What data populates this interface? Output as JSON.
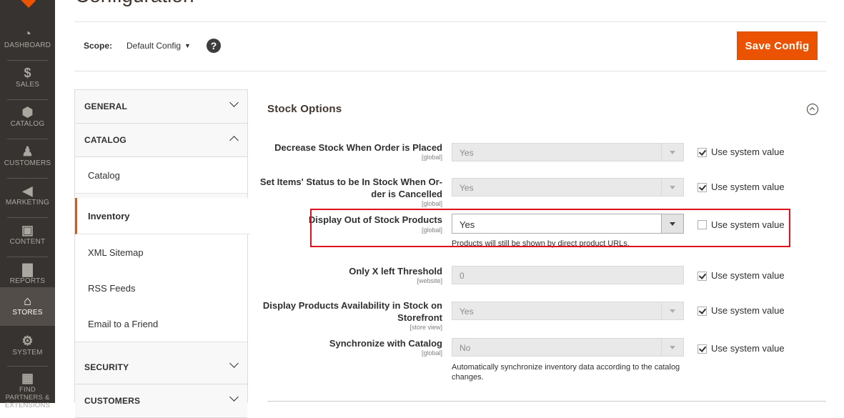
{
  "nav": [
    {
      "label": "DASHBOARD",
      "icon": "dashboard-icon",
      "glyph": "◔"
    },
    {
      "label": "SALES",
      "icon": "dollar-icon",
      "glyph": "$"
    },
    {
      "label": "CATALOG",
      "icon": "cube-icon",
      "glyph": "⬢"
    },
    {
      "label": "CUSTOMERS",
      "icon": "person-icon",
      "glyph": "♟"
    },
    {
      "label": "MARKETING",
      "icon": "megaphone-icon",
      "glyph": "◀"
    },
    {
      "label": "CONTENT",
      "icon": "layout-icon",
      "glyph": "▣"
    },
    {
      "label": "REPORTS",
      "icon": "bar-chart-icon",
      "glyph": "▇"
    },
    {
      "label": "STORES",
      "icon": "store-icon",
      "glyph": "⌂"
    },
    {
      "label": "SYSTEM",
      "icon": "gear-icon",
      "glyph": "⚙"
    },
    {
      "label": "FIND PARTNERS & EXTENSIONS",
      "icon": "boxes-icon",
      "glyph": "▦"
    }
  ],
  "page": {
    "title": "Configuration"
  },
  "scope": {
    "label": "Scope:",
    "value": "Default Config",
    "help": "?"
  },
  "save_label": "Save Config",
  "tabs": {
    "general": "GENERAL",
    "catalog": "CATALOG",
    "catalog_items": [
      "Catalog",
      "Inventory",
      "XML Sitemap",
      "RSS Feeds",
      "Email to a Friend"
    ],
    "security": "SECURITY",
    "customers": "CUSTOMERS"
  },
  "section": {
    "title": "Stock Options"
  },
  "fields": {
    "decrease": {
      "label": "Decrease Stock When Order is Placed",
      "scope": "[global]",
      "value": "Yes",
      "system": "Use system value"
    },
    "set_status": {
      "label_line1": "Set Items' Status to be In Stock When Or-",
      "label_line2": "der is Cancelled",
      "scope": "[global]",
      "value": "Yes",
      "system": "Use system value"
    },
    "display_oos": {
      "label": "Display Out of Stock Products",
      "scope": "[global]",
      "value": "Yes",
      "system": "Use system value",
      "comment": "Products will still be shown by direct product URLs."
    },
    "threshold": {
      "label": "Only X left Threshold",
      "scope": "[website]",
      "value": "0",
      "system": "Use system value"
    },
    "availability": {
      "label_line1": "Display Products Availability in Stock on",
      "label_line2": "Storefront",
      "scope": "[store view]",
      "value": "Yes",
      "system": "Use system value"
    },
    "sync": {
      "label": "Synchronize with Catalog",
      "scope": "[global]",
      "value": "No",
      "system": "Use system value",
      "comment_line1": "Automatically synchronize inventory data according to the catalog",
      "comment_line2": "changes."
    }
  },
  "colors": {
    "accent": "#eb5202",
    "nav_bg": "#373330",
    "highlight": "#e0111c"
  }
}
